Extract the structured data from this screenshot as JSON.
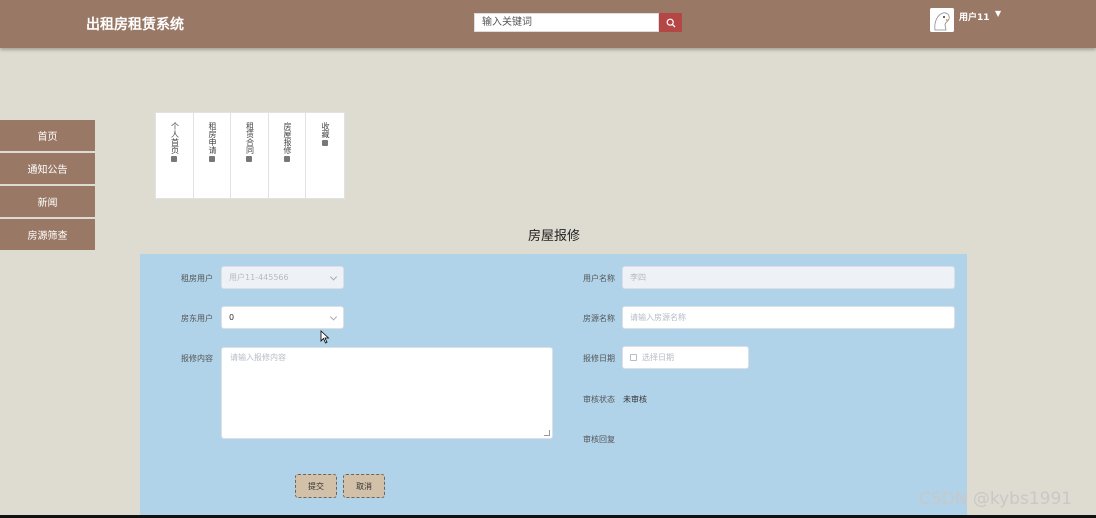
{
  "header": {
    "app_title": "出租房租赁系统",
    "search_placeholder": "输入关键词",
    "username": "用户11"
  },
  "sidebar": {
    "items": [
      {
        "label": "首页"
      },
      {
        "label": "通知公告"
      },
      {
        "label": "新闻"
      },
      {
        "label": "房源筛查"
      }
    ]
  },
  "subnav": {
    "items": [
      {
        "label": "个人首页"
      },
      {
        "label": "租房申请"
      },
      {
        "label": "租赁合同"
      },
      {
        "label": "房屋报修"
      },
      {
        "label": "收藏"
      }
    ]
  },
  "page": {
    "title": "房屋报修"
  },
  "form": {
    "tenant_label": "租房用户",
    "tenant_value": "用户11-445566",
    "landlord_label": "房东用户",
    "landlord_value": "0",
    "content_label": "报修内容",
    "content_placeholder": "请输入报修内容",
    "username_label": "用户名称",
    "username_value": "李四",
    "house_label": "房源名称",
    "house_placeholder": "请输入房源名称",
    "date_label": "报修日期",
    "date_placeholder": "选择日期",
    "status_label": "审核状态",
    "status_value": "未审核",
    "reply_label": "审核回复",
    "submit_label": "提交",
    "cancel_label": "取消"
  },
  "watermark": "CSDN @kybs1991",
  "colors": {
    "header_bg": "#9a7866",
    "page_bg": "#dedbd0",
    "form_bg": "#b0d3ea",
    "search_button": "#b54646",
    "button_bg": "#d2c1a8"
  }
}
